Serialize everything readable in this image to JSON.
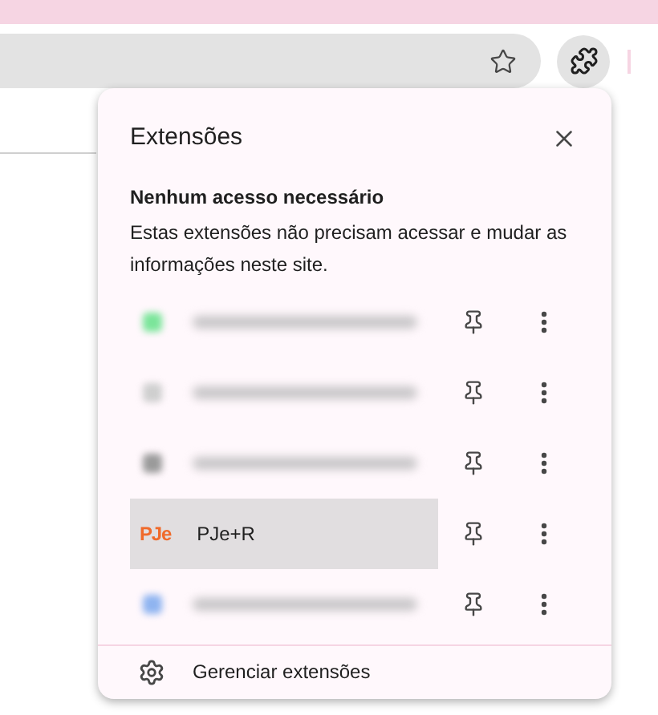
{
  "popup": {
    "title": "Extensões",
    "section_heading": "Nenhum acesso necessário",
    "section_description": "Estas extensões não precisam acessar e mudar as informações neste site.",
    "extensions": [
      {
        "kind": "blurred",
        "color": "#7be59a",
        "highlighted": false
      },
      {
        "kind": "blurred",
        "color": "#cfcfcf",
        "highlighted": false
      },
      {
        "kind": "blurred",
        "color": "#9a9a9a",
        "highlighted": false
      },
      {
        "kind": "named",
        "logo": "PJe",
        "name": "PJe+R",
        "highlighted": true
      },
      {
        "kind": "blurred",
        "color": "#8fb4f0",
        "highlighted": false
      }
    ],
    "footer": {
      "label": "Gerenciar extensões"
    }
  }
}
